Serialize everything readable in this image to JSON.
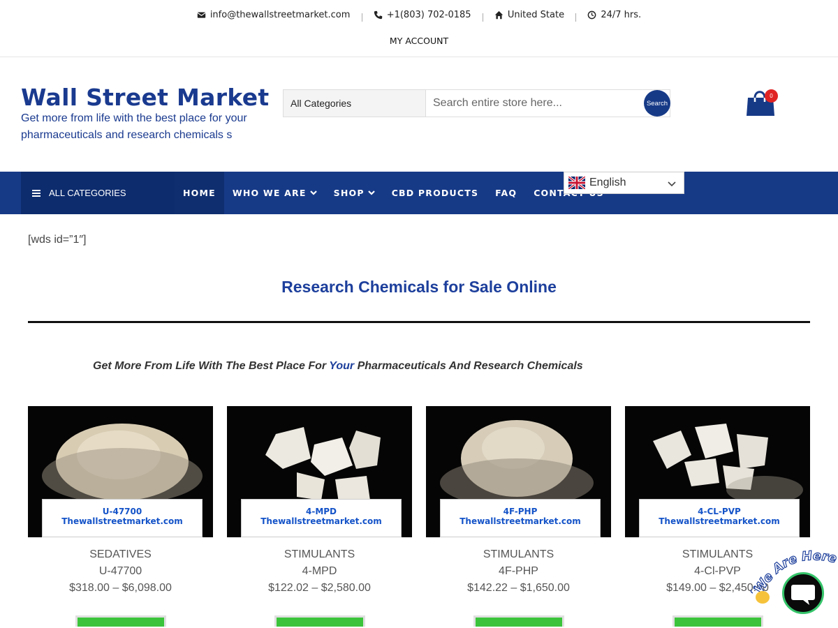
{
  "topbar": {
    "email": "info@thewallstreetmarket.com",
    "phone": "+1(803) 702-0185",
    "location": "United State",
    "hours": "24/7 hrs.",
    "my_account": "MY ACCOUNT"
  },
  "header": {
    "logo": "Wall Street Market",
    "tagline": "Get more from life with the best place for your pharmaceuticals and research chemicals s",
    "search": {
      "category": "All Categories",
      "placeholder": "Search entire store here...",
      "button": "Search"
    },
    "cart_count": "0"
  },
  "nav": {
    "all_categories": "ALL CATEGORIES",
    "items": [
      {
        "label": "HOME"
      },
      {
        "label": "WHO WE ARE"
      },
      {
        "label": "SHOP"
      },
      {
        "label": "CBD PRODUCTS"
      },
      {
        "label": "FAQ"
      },
      {
        "label": "CONTACT US"
      }
    ],
    "language": "English"
  },
  "content": {
    "shortcode": "[wds id=”1″]",
    "heading": "Research Chemicals for Sale Online",
    "sub_pre": "Get More From Life With The Best Place For ",
    "sub_hl": "Your",
    "sub_post": " Pharmaceuticals And Research Chemicals"
  },
  "products": [
    {
      "category": "SEDATIVES",
      "name": "U-47700",
      "price": "$318.00 – $6,098.00",
      "label1": "U-47700",
      "label2": "Thewallstreetmarket.com"
    },
    {
      "category": "STIMULANTS",
      "name": "4-MPD",
      "price": "$122.02 – $2,580.00",
      "label1": "4-MPD",
      "label2": "Thewallstreetmarket.com"
    },
    {
      "category": "STIMULANTS",
      "name": "4F-PHP",
      "price": "$142.22 – $1,650.00",
      "label1": "4F-PHP",
      "label2": "Thewallstreetmarket.com"
    },
    {
      "category": "STIMULANTS",
      "name": "4-Cl-PVP",
      "price": "$149.00 – $2,450.00",
      "label1": "4-CL-PVP",
      "label2": "Thewallstreetmarket.com"
    }
  ],
  "chat": {
    "badge_text": "We Are Here!"
  },
  "colors": {
    "brand_blue": "#173a87",
    "nav_dark": "#0d2c6e",
    "cart_badge": "#e02424",
    "button_green": "#3bc43b"
  }
}
